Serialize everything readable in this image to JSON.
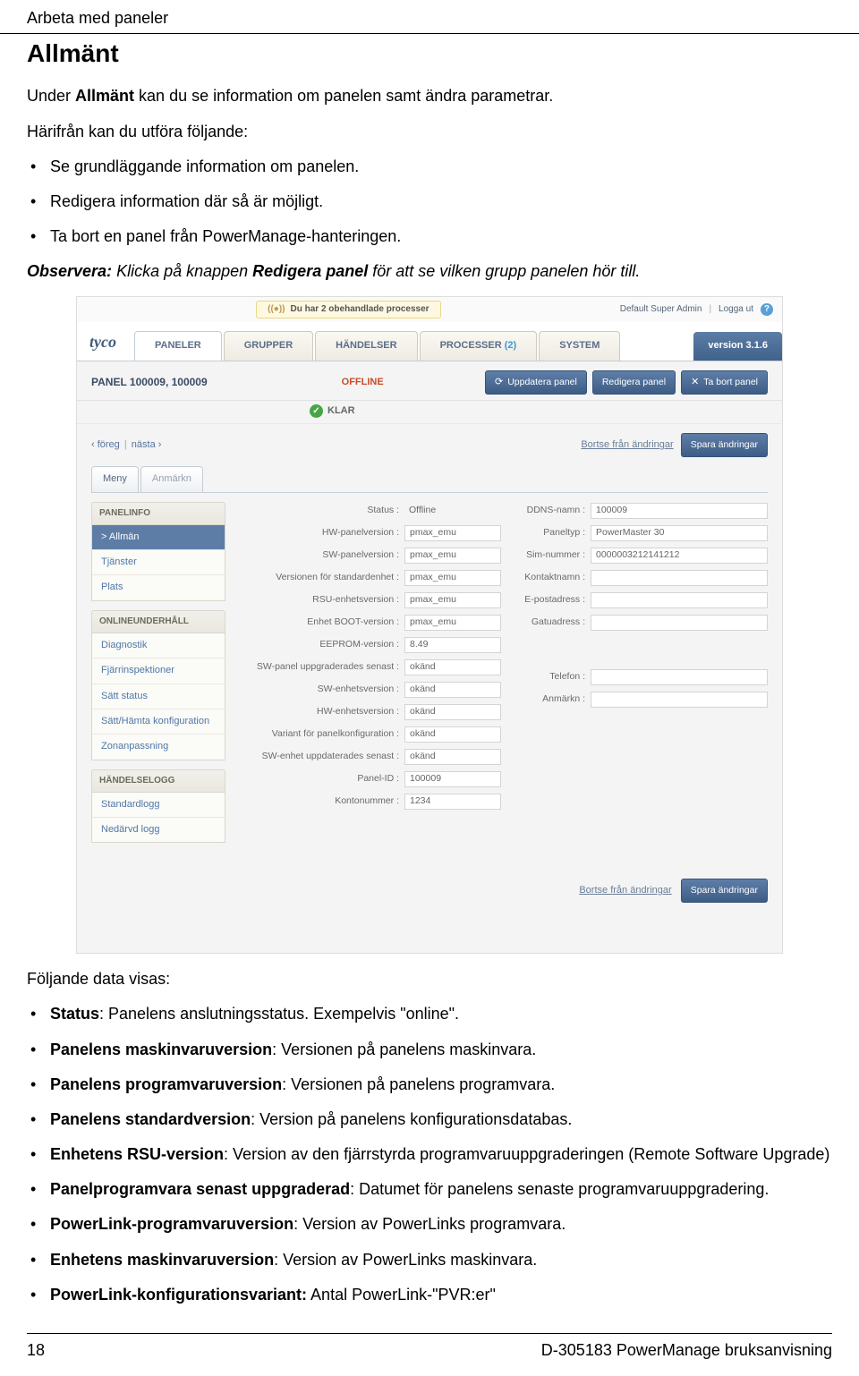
{
  "header": {
    "page_title": "Arbeta med paneler",
    "section_title": "Allmänt"
  },
  "intro": {
    "line1_pre": "Under ",
    "line1_bold": "Allmänt",
    "line1_post": " kan du se information om panelen samt ändra parametrar.",
    "line2": "Härifrån kan du utföra följande:"
  },
  "top_bullets": [
    "Se grundläggande information om panelen.",
    "Redigera information där så är möjligt.",
    "Ta bort en panel från PowerManage-hanteringen."
  ],
  "observera": {
    "prefix_bold": "Observera:",
    "mid": " Klicka på knappen ",
    "mid_bold": "Redigera panel",
    "post": " för att se vilken grupp panelen hör till."
  },
  "app": {
    "proc_msg": "Du har 2 obehandlade processer",
    "user": "Default Super Admin",
    "logout": "Logga ut",
    "brand": "tyco",
    "navtabs": {
      "paneler": "PANELER",
      "grupper": "GRUPPER",
      "handelser": "HÄNDELSER",
      "processer": "PROCESSER",
      "processer_count": "(2)",
      "system": "SYSTEM"
    },
    "version": "version 3.1.6",
    "panel_name": "PANEL 100009, 100009",
    "offline": "OFFLINE",
    "btn_refresh": "Uppdatera panel",
    "btn_edit": "Redigera panel",
    "btn_remove": "Ta bort panel",
    "klar": "KLAR",
    "prev": "‹ föreg",
    "next": "nästa ›",
    "discard": "Bortse från ändringar",
    "save": "Spara ändringar",
    "tab_menu": "Meny",
    "tab_remark": "Anmärkn",
    "side": {
      "hdr1": "PANELINFO",
      "items1": [
        "Allmän",
        "Tjänster",
        "Plats"
      ],
      "hdr2": "ONLINEUNDERHÅLL",
      "items2": [
        "Diagnostik",
        "Fjärrinspektioner",
        "Sätt status",
        "Sätt/Hämta konfiguration",
        "Zonanpassning"
      ],
      "hdr3": "HÄNDELSELOGG",
      "items3": [
        "Standardlogg",
        "Nedärvd logg"
      ]
    },
    "left_fields": [
      {
        "label": "Status :",
        "value": "Offline",
        "readonly": true
      },
      {
        "label": "HW-panelversion :",
        "value": "pmax_emu"
      },
      {
        "label": "SW-panelversion :",
        "value": "pmax_emu"
      },
      {
        "label": "Versionen för standardenhet :",
        "value": "pmax_emu"
      },
      {
        "label": "RSU-enhetsversion :",
        "value": "pmax_emu"
      },
      {
        "label": "Enhet BOOT-version :",
        "value": "pmax_emu"
      },
      {
        "label": "EEPROM-version :",
        "value": "8.49"
      },
      {
        "label": "SW-panel uppgraderades senast :",
        "value": "okänd"
      },
      {
        "label": "SW-enhetsversion :",
        "value": "okänd"
      },
      {
        "label": "HW-enhetsversion :",
        "value": "okänd"
      },
      {
        "label": "Variant för panelkonfiguration :",
        "value": "okänd"
      },
      {
        "label": "SW-enhet uppdaterades senast :",
        "value": "okänd"
      },
      {
        "label": "Panel-ID :",
        "value": "100009"
      },
      {
        "label": "Kontonummer :",
        "value": "1234"
      }
    ],
    "right_fields": [
      {
        "label": "DDNS-namn :",
        "value": "100009"
      },
      {
        "label": "Paneltyp :",
        "value": "PowerMaster 30"
      },
      {
        "label": "Sim-nummer :",
        "value": "0000003212141212"
      },
      {
        "label": "Kontaktnamn :",
        "value": ""
      },
      {
        "label": "E-postadress :",
        "value": ""
      },
      {
        "label": "Gatuadress :",
        "value": ""
      },
      {
        "label": "Telefon :",
        "value": ""
      },
      {
        "label": "Anmärkn :",
        "value": ""
      }
    ]
  },
  "after_img": "Följande data visas:",
  "def_bullets": [
    {
      "bold": "Status",
      "text": ": Panelens anslutningsstatus. Exempelvis \"online\"."
    },
    {
      "bold": "Panelens maskinvaruversion",
      "text": ": Versionen på panelens maskinvara."
    },
    {
      "bold": "Panelens programvaruversion",
      "text": ": Versionen på panelens programvara."
    },
    {
      "bold": "Panelens standardversion",
      "text": ": Version på panelens konfigurationsdatabas."
    },
    {
      "bold": "Enhetens RSU-version",
      "text": ": Version av den fjärrstyrda programvaruuppgraderingen (Remote Software Upgrade)"
    },
    {
      "bold": "Panelprogramvara senast uppgraderad",
      "text": ": Datumet för panelens senaste programvaruuppgradering."
    },
    {
      "bold": "PowerLink-programvaruversion",
      "text": ": Version av PowerLinks programvara."
    },
    {
      "bold": "Enhetens maskinvaruversion",
      "text": ": Version av PowerLinks maskinvara."
    },
    {
      "bold": "PowerLink-konfigurationsvariant:",
      "text": " Antal PowerLink-\"PVR:er\""
    }
  ],
  "footer": {
    "page": "18",
    "doc": "D-305183 PowerManage bruksanvisning"
  }
}
